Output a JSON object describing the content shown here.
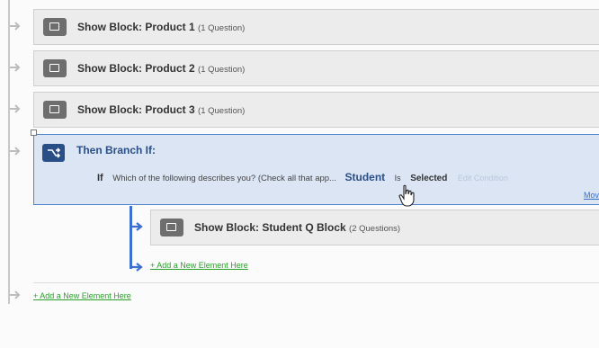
{
  "flow": {
    "blocks": [
      {
        "title": "Show Block: Product 1",
        "count": "(1 Question)"
      },
      {
        "title": "Show Block: Product 2",
        "count": "(1 Question)"
      },
      {
        "title": "Show Block: Product 3",
        "count": "(1 Question)"
      }
    ],
    "branch": {
      "title": "Then Branch If:",
      "condition": {
        "if_label": "If",
        "question": "Which of the following describes you? (Check all that app...",
        "value": "Student",
        "operator": "Is",
        "state": "Selected",
        "edit_link": "Edit Condition"
      },
      "more_link": "Mov",
      "sub_block": {
        "title": "Show Block: Student Q Block",
        "count": "(2 Questions)"
      },
      "add_link": "+ Add a New Element Here"
    },
    "add_link": "+ Add a New Element Here"
  },
  "colors": {
    "branch_accent": "#2a4f86",
    "branch_bg": "#dbe5f4",
    "branch_line": "#3b6fd0",
    "add_link": "#2aa02a"
  }
}
